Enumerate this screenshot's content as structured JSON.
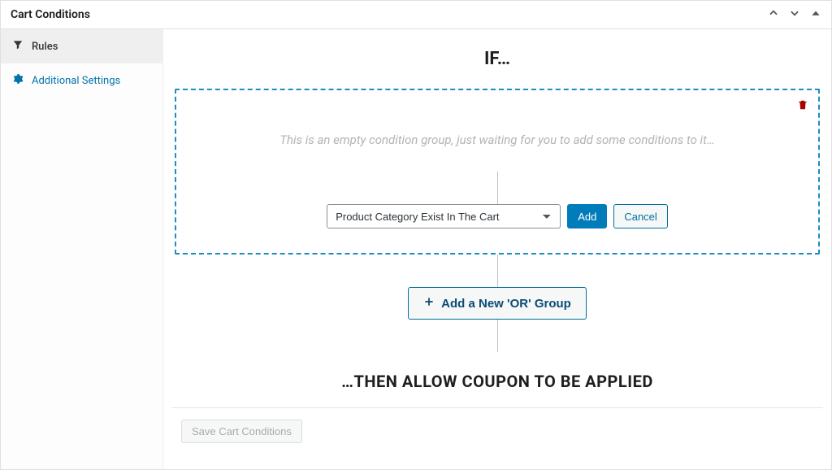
{
  "panel": {
    "title": "Cart Conditions"
  },
  "sidebar": {
    "items": [
      {
        "label": "Rules"
      },
      {
        "label": "Additional Settings"
      }
    ]
  },
  "main": {
    "if_heading": "IF…",
    "group": {
      "placeholder": "This is an empty condition group, just waiting for you to add some conditions to it…",
      "select_value": "Product Category Exist In The Cart",
      "add_label": "Add",
      "cancel_label": "Cancel"
    },
    "or_button_label": "Add a New 'OR' Group",
    "then_heading": "…THEN ALLOW COUPON TO BE APPLIED"
  },
  "footer": {
    "save_label": "Save Cart Conditions"
  }
}
